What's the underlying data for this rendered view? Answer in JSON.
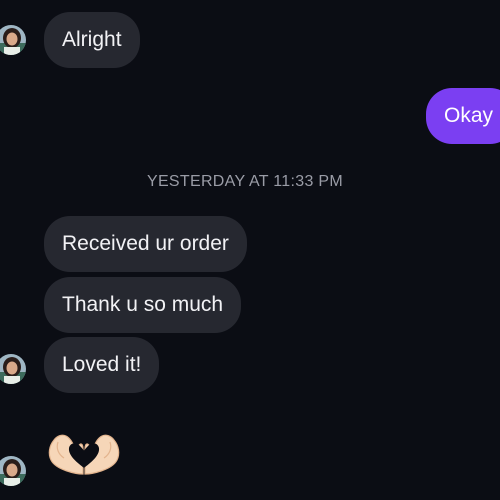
{
  "conversation": {
    "messages": [
      {
        "sender": "other",
        "text": "Alright"
      },
      {
        "sender": "me",
        "text": "Okay"
      },
      {
        "sender": "other",
        "text": "Received ur order"
      },
      {
        "sender": "other",
        "text": "Thank u so much"
      },
      {
        "sender": "other",
        "text": "Loved it!"
      }
    ],
    "timestamp": "YESTERDAY AT 11:33 PM",
    "reaction_emoji": "heart-hands-emoji"
  },
  "icons": {
    "avatar": "contact-avatar",
    "emoji": "heart-hands-emoji"
  },
  "colors": {
    "background": "#0b0d14",
    "incoming_bubble": "#262830",
    "outgoing_bubble": "#7b3ff2",
    "timestamp_text": "#9a9ca6"
  }
}
